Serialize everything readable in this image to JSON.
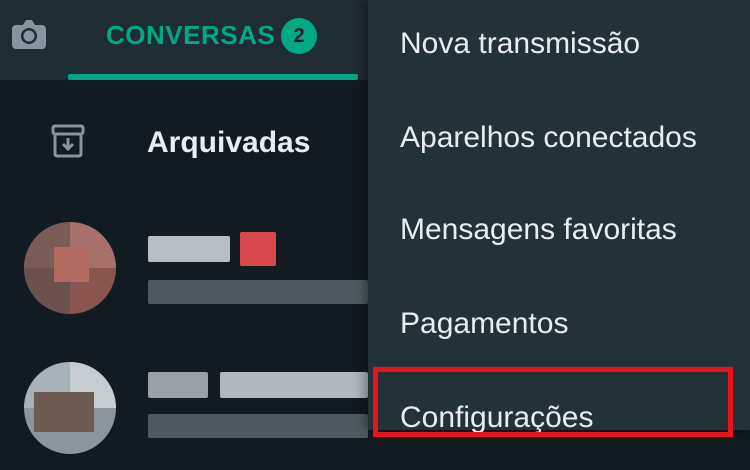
{
  "header": {
    "camera_icon": "camera-icon",
    "tab": {
      "label": "CONVERSAS",
      "badge": "2"
    },
    "accent_color": "#00a884"
  },
  "chat_list": {
    "archived": {
      "icon": "archive-icon",
      "label": "Arquivadas"
    }
  },
  "overflow_menu": {
    "items": [
      {
        "label": "Nova transmissão"
      },
      {
        "label": "Aparelhos conectados"
      },
      {
        "label": "Mensagens favoritas"
      },
      {
        "label": "Pagamentos"
      },
      {
        "label": "Configurações",
        "highlighted": true
      }
    ],
    "highlight_color": "#e8141a"
  }
}
